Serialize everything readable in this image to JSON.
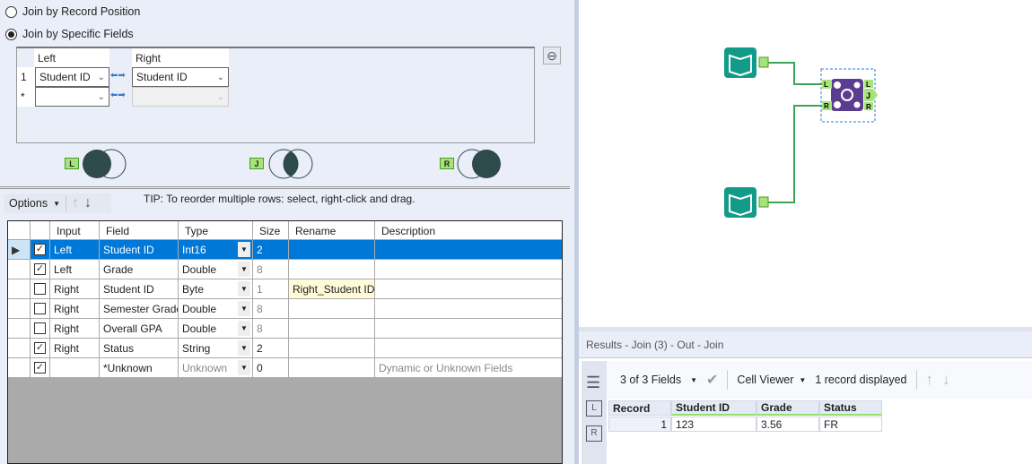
{
  "join_options": {
    "by_position": "Join by Record Position",
    "by_fields": "Join by Specific Fields",
    "selected": "by_fields"
  },
  "join_fields": {
    "left_header": "Left",
    "right_header": "Right",
    "rows": [
      {
        "num": "1",
        "left": "Student ID",
        "right": "Student ID"
      },
      {
        "num": "*",
        "left": "",
        "right": ""
      }
    ]
  },
  "venn": {
    "left_tag": "L",
    "join_tag": "J",
    "right_tag": "R"
  },
  "toolbar": {
    "options_label": "Options",
    "tip": "TIP: To reorder multiple rows: select, right-click and drag."
  },
  "select_grid": {
    "headers": [
      "Input",
      "Field",
      "Type",
      "Size",
      "Rename",
      "Description"
    ],
    "rows": [
      {
        "checked": true,
        "input": "Left",
        "field": "Student ID",
        "type": "Int16",
        "size": "2",
        "rename": "",
        "description": "",
        "selected": true
      },
      {
        "checked": true,
        "input": "Left",
        "field": "Grade",
        "type": "Double",
        "size": "8",
        "rename": "",
        "description": ""
      },
      {
        "checked": false,
        "input": "Right",
        "field": "Student ID",
        "type": "Byte",
        "size": "1",
        "rename": "Right_Student ID",
        "description": ""
      },
      {
        "checked": false,
        "input": "Right",
        "field": "Semester Grade",
        "type": "Double",
        "size": "8",
        "rename": "",
        "description": ""
      },
      {
        "checked": false,
        "input": "Right",
        "field": "Overall GPA",
        "type": "Double",
        "size": "8",
        "rename": "",
        "description": ""
      },
      {
        "checked": true,
        "input": "Right",
        "field": "Status",
        "type": "String",
        "size": "2",
        "rename": "",
        "description": ""
      },
      {
        "checked": true,
        "input": "",
        "field": "*Unknown",
        "type": "Unknown",
        "size": "0",
        "rename": "",
        "description": "Dynamic or Unknown Fields"
      }
    ]
  },
  "canvas": {
    "join_anchors": {
      "in_left": "L",
      "in_right": "R",
      "out_left": "L",
      "out_join": "J",
      "out_right": "R"
    }
  },
  "results": {
    "title": "Results - Join (3) - Out - Join",
    "fields_label": "3 of 3 Fields",
    "viewer_label": "Cell Viewer",
    "records_label": "1 record displayed",
    "side_tabs": [
      "L",
      "R"
    ],
    "headers": [
      "Record",
      "Student ID",
      "Grade",
      "Status"
    ],
    "rows": [
      [
        "1",
        "123",
        "3.56",
        "FR"
      ]
    ]
  },
  "colors": {
    "selection": "#0078d7",
    "tool_input": "#139b8a",
    "tool_join": "#5b3d8f",
    "connector": "#3aa55a"
  }
}
